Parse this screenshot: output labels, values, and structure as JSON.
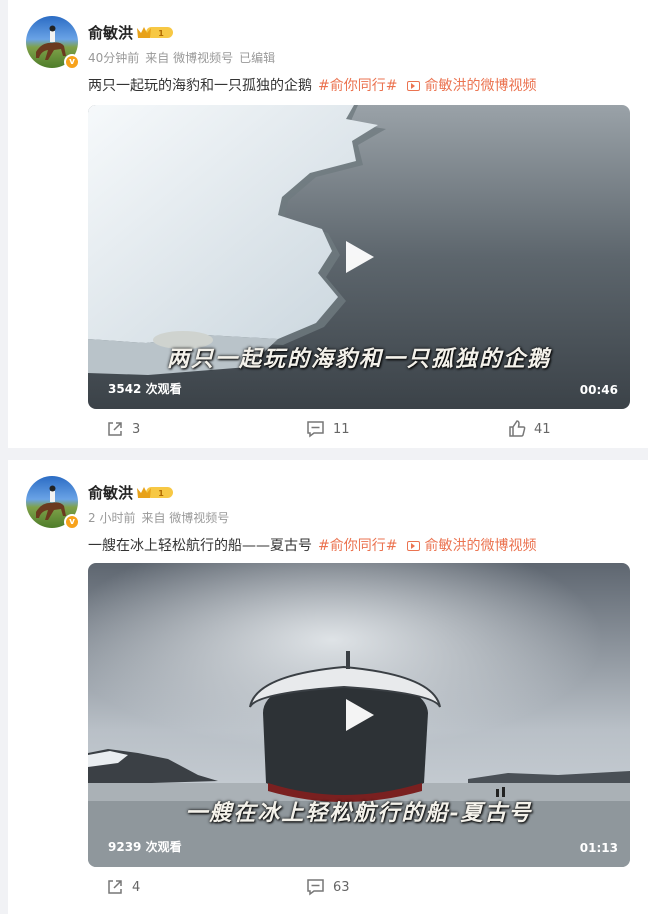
{
  "posts": [
    {
      "author": "俞敏洪",
      "level": "1",
      "time": "40分钟前",
      "source": "来自 微博视频号",
      "edited": "已编辑",
      "text": "两只一起玩的海豹和一只孤独的企鹅",
      "tag": "#俞你同行#",
      "video_link": "俞敏洪的微博视频",
      "video": {
        "subtitle": "两只一起玩的海豹和一只孤独的企鹅",
        "views": "3542 次观看",
        "duration": "00:46"
      },
      "actions": {
        "reposts": "3",
        "comments": "11",
        "likes": "41"
      }
    },
    {
      "author": "俞敏洪",
      "level": "1",
      "time": "2 小时前",
      "source": "来自 微博视频号",
      "text": "一艘在冰上轻松航行的船——夏古号",
      "tag": "#俞你同行#",
      "video_link": "俞敏洪的微博视频",
      "video": {
        "subtitle": "一艘在冰上轻松航行的船-夏古号",
        "views": "9239 次观看",
        "duration": "01:13"
      },
      "actions": {
        "reposts": "4",
        "comments": "63"
      }
    }
  ],
  "colors": {
    "accent": "#eb7350",
    "meta": "#999999",
    "background": "#f1f2f5"
  },
  "icons": [
    "avatar-image",
    "verified-badge-icon",
    "vip-crown-icon",
    "video-icon",
    "play-icon",
    "repost-icon",
    "comment-icon",
    "like-icon"
  ]
}
